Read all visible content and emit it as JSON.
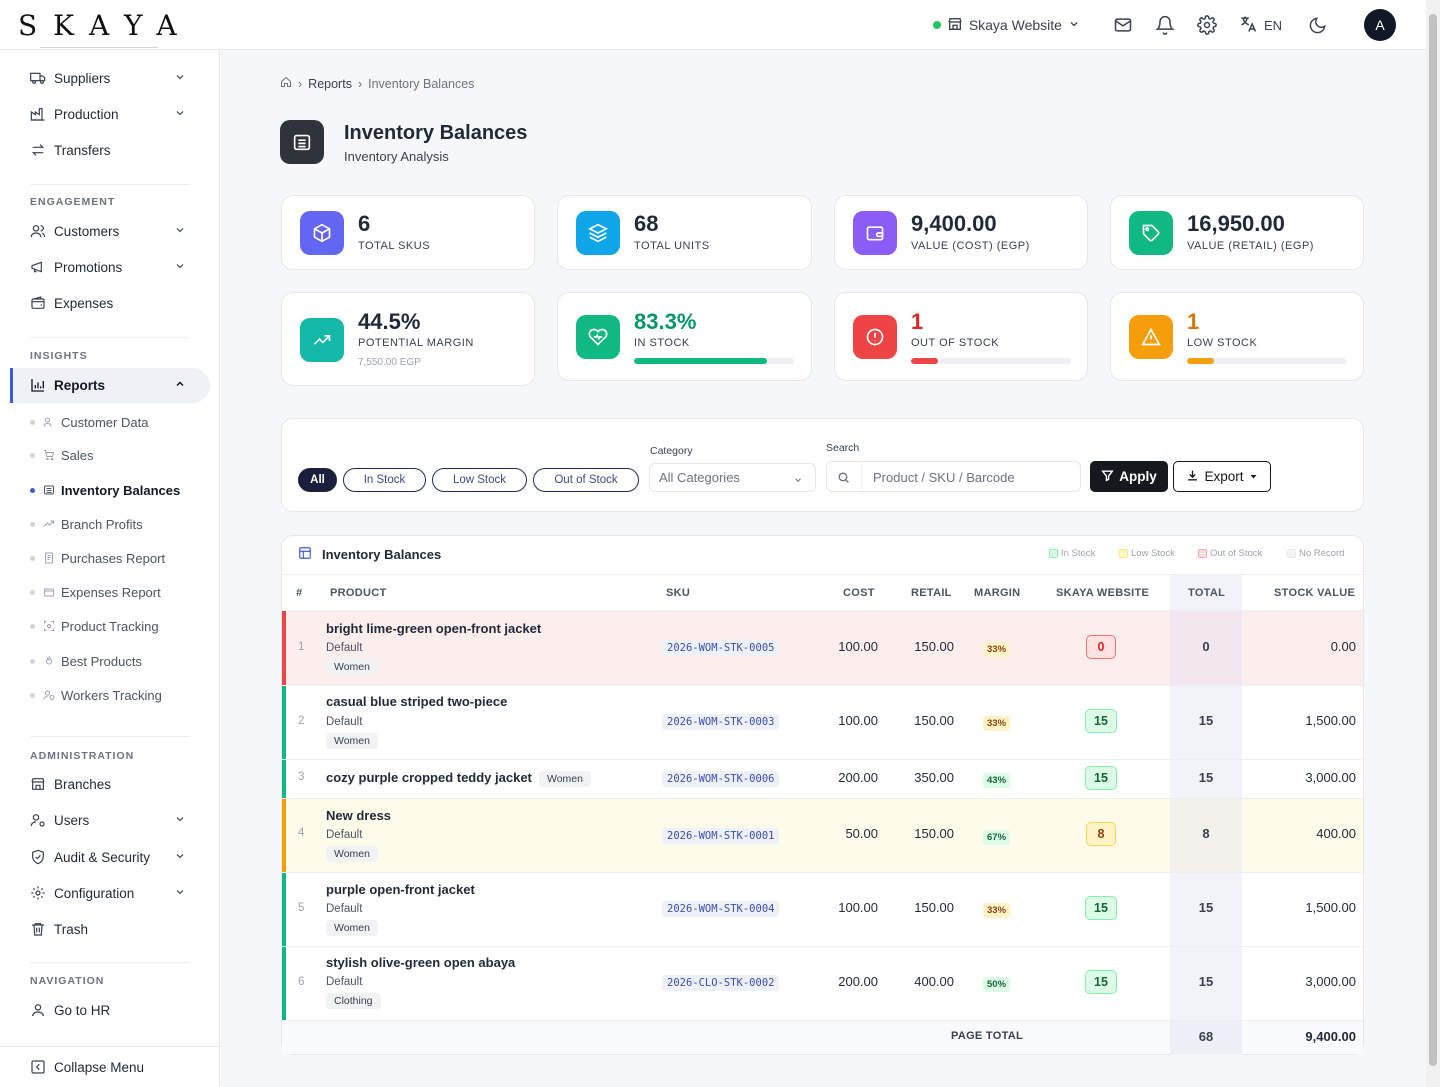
{
  "brand": {
    "logo_text": "SKAYA"
  },
  "topbar": {
    "store": "Skaya Website",
    "lang": "EN",
    "avatar": "A",
    "icons": [
      "store-icon",
      "mail-icon",
      "bell-icon",
      "gear-icon",
      "translate-icon",
      "moon-icon"
    ]
  },
  "sidebar": {
    "top_items": [
      {
        "label": "Suppliers",
        "icon": "truck-icon",
        "chevron": true
      },
      {
        "label": "Production",
        "icon": "factory-icon",
        "chevron": true
      },
      {
        "label": "Transfers",
        "icon": "transfer-icon",
        "chevron": false
      }
    ],
    "engagement_label": "ENGAGEMENT",
    "engagement": [
      {
        "label": "Customers",
        "chevron": true
      },
      {
        "label": "Promotions",
        "chevron": true
      },
      {
        "label": "Expenses",
        "chevron": false
      }
    ],
    "insights_label": "INSIGHTS",
    "reports_label": "Reports",
    "reports_sub": [
      "Customer Data",
      "Sales",
      "Inventory Balances",
      "Branch Profits",
      "Purchases Report",
      "Expenses Report",
      "Product Tracking",
      "Best Products",
      "Workers Tracking"
    ],
    "administration_label": "ADMINISTRATION",
    "administration": [
      {
        "label": "Branches",
        "chevron": false
      },
      {
        "label": "Users",
        "chevron": true
      },
      {
        "label": "Audit & Security",
        "chevron": true
      },
      {
        "label": "Configuration",
        "chevron": true
      },
      {
        "label": "Trash",
        "chevron": false
      }
    ],
    "navigation_label": "NAVIGATION",
    "go_to_hr": "Go to HR",
    "collapse": "Collapse Menu"
  },
  "breadcrumb": {
    "reports": "Reports",
    "current": "Inventory Balances"
  },
  "page": {
    "title": "Inventory Balances",
    "subtitle": "Inventory Analysis"
  },
  "stats": [
    {
      "value": "6",
      "label": "TOTAL SKUS",
      "color": "#6366f1"
    },
    {
      "value": "68",
      "label": "TOTAL UNITS",
      "color": "#0ea5e9"
    },
    {
      "value": "9,400.00",
      "label": "VALUE (COST) (EGP)",
      "color": "#8b5cf6"
    },
    {
      "value": "16,950.00",
      "label": "VALUE (RETAIL) (EGP)",
      "color": "#10b981"
    },
    {
      "value": "44.5%",
      "label": "POTENTIAL MARGIN",
      "sub": "7,550.00 EGP",
      "color": "#14b8a6"
    },
    {
      "value": "83.3%",
      "label": "IN STOCK",
      "fraction": 0.833,
      "color": "#10b981"
    },
    {
      "value": "1",
      "label": "OUT OF STOCK",
      "fraction": 0.167,
      "color": "#ef4444"
    },
    {
      "value": "1",
      "label": "LOW STOCK",
      "fraction": 0.167,
      "color": "#f59e0b"
    }
  ],
  "filters": {
    "pills": [
      "All",
      "In Stock",
      "Low Stock",
      "Out of Stock"
    ],
    "category_label": "Category",
    "category_value": "All Categories",
    "search_label": "Search",
    "search_placeholder": "Product / SKU / Barcode",
    "apply": "Apply",
    "export": "Export"
  },
  "table": {
    "title": "Inventory Balances",
    "legend": [
      "In Stock",
      "Low Stock",
      "Out of Stock",
      "No Record"
    ],
    "columns": [
      "#",
      "PRODUCT",
      "SKU",
      "COST",
      "RETAIL",
      "MARGIN",
      "SKAYA WEBSITE",
      "TOTAL",
      "STOCK VALUE"
    ],
    "rows": [
      {
        "n": "1",
        "name": "bright lime-green open-front jacket",
        "variant": "Default",
        "tag": "Women",
        "sku": "2026-WOM-STK-0005",
        "cost": "100.00",
        "retail": "150.00",
        "margin": "33%",
        "qty": "0",
        "total": "0",
        "value": "0.00",
        "status": "out"
      },
      {
        "n": "2",
        "name": "casual blue striped two-piece",
        "variant": "Default",
        "tag": "Women",
        "sku": "2026-WOM-STK-0003",
        "cost": "100.00",
        "retail": "150.00",
        "margin": "33%",
        "qty": "15",
        "total": "15",
        "value": "1,500.00",
        "status": "in"
      },
      {
        "n": "3",
        "name": "cozy purple cropped teddy jacket",
        "variant": "",
        "tag": "Women",
        "sku": "2026-WOM-STK-0006",
        "cost": "200.00",
        "retail": "350.00",
        "margin": "43%",
        "qty": "15",
        "total": "15",
        "value": "3,000.00",
        "status": "in"
      },
      {
        "n": "4",
        "name": "New dress",
        "variant": "Default",
        "tag": "Women",
        "sku": "2026-WOM-STK-0001",
        "cost": "50.00",
        "retail": "150.00",
        "margin": "67%",
        "qty": "8",
        "total": "8",
        "value": "400.00",
        "status": "low"
      },
      {
        "n": "5",
        "name": "purple open-front jacket",
        "variant": "Default",
        "tag": "Women",
        "sku": "2026-WOM-STK-0004",
        "cost": "100.00",
        "retail": "150.00",
        "margin": "33%",
        "qty": "15",
        "total": "15",
        "value": "1,500.00",
        "status": "in"
      },
      {
        "n": "6",
        "name": "stylish olive-green open abaya",
        "variant": "Default",
        "tag": "Clothing",
        "sku": "2026-CLO-STK-0002",
        "cost": "200.00",
        "retail": "400.00",
        "margin": "50%",
        "qty": "15",
        "total": "15",
        "value": "3,000.00",
        "status": "in"
      }
    ],
    "footer_label": "PAGE TOTAL",
    "footer_total": "68",
    "footer_value": "9,400.00"
  }
}
